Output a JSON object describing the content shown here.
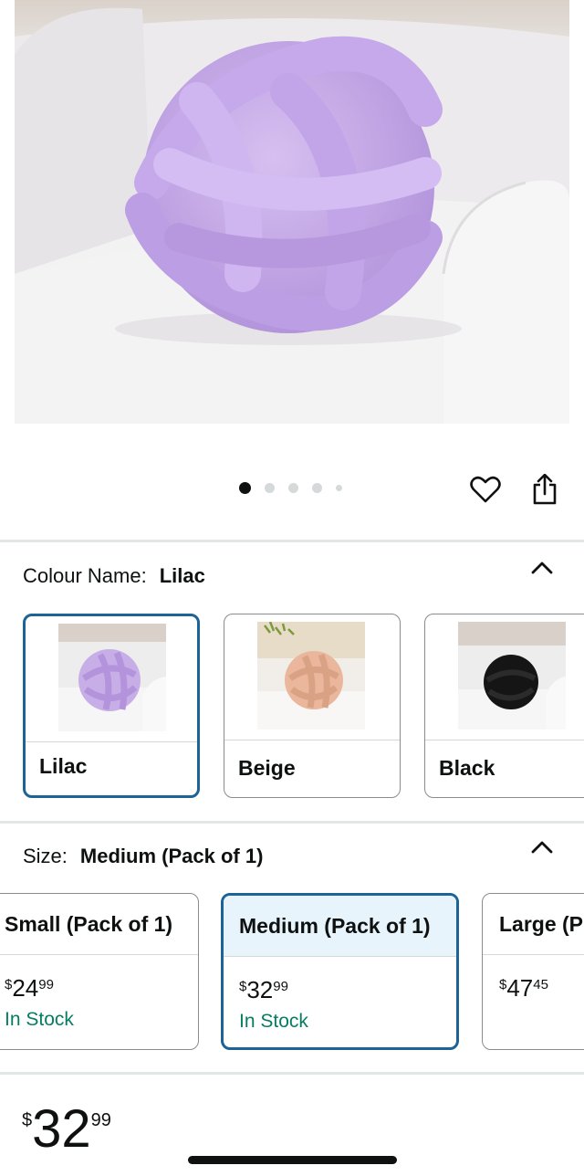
{
  "product": {
    "image_alt": "Lilac knot pillow on white sofa",
    "carousel": {
      "total": 5,
      "active": 1
    }
  },
  "icons": {
    "favorite": "heart-icon",
    "share": "share-icon",
    "collapse": "chevron-up-icon"
  },
  "colour": {
    "label": "Colour Name:",
    "selected": "Lilac",
    "options": [
      {
        "name": "Lilac",
        "color": "#c8aee6"
      },
      {
        "name": "Beige",
        "color": "#eab79c"
      },
      {
        "name": "Black",
        "color": "#151515"
      }
    ]
  },
  "size": {
    "label": "Size:",
    "selected": "Medium (Pack of 1)",
    "options": [
      {
        "name": "Small (Pack of 1)",
        "currency": "$",
        "price_whole": "24",
        "price_cents": "99",
        "stock": "In Stock"
      },
      {
        "name": "Medium (Pack of 1)",
        "currency": "$",
        "price_whole": "32",
        "price_cents": "99",
        "stock": "In Stock"
      },
      {
        "name": "Large (P",
        "currency": "$",
        "price_whole": "47",
        "price_cents": "45",
        "stock": ""
      }
    ]
  },
  "price": {
    "currency": "$",
    "whole": "32",
    "cents": "99"
  },
  "colors": {
    "accent": "#1d6395",
    "stock_green": "#067d62",
    "selected_bg": "#e8f4fb"
  }
}
